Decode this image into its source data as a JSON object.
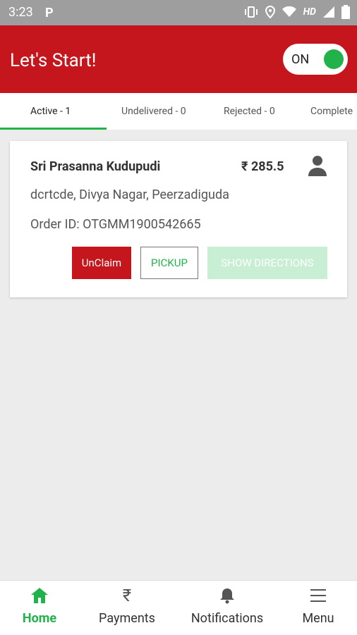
{
  "status_bar": {
    "time": "3:23",
    "left_icon": "P",
    "network_label": "HD"
  },
  "app_bar": {
    "title": "Let's Start!",
    "toggle_label": "ON"
  },
  "tabs": [
    {
      "label": "Active - 1"
    },
    {
      "label": "Undelivered - 0"
    },
    {
      "label": "Rejected - 0"
    },
    {
      "label": "Complete"
    }
  ],
  "order_card": {
    "customer_name": "Sri Prasanna Kudupudi",
    "price": "₹ 285.5",
    "address": "dcrtcde, Divya Nagar, Peerzadiguda",
    "order_id": "Order ID: OTGMM1900542665",
    "buttons": {
      "unclaim": "UnClaim",
      "pickup": "PICKUP",
      "show_directions": "SHOW DIRECTIONS"
    }
  },
  "bottom_nav": [
    {
      "label": "Home",
      "icon": "home-icon"
    },
    {
      "label": "Payments",
      "icon": "rupee-icon"
    },
    {
      "label": "Notifications",
      "icon": "bell-icon"
    },
    {
      "label": "Menu",
      "icon": "hamburger-icon"
    }
  ],
  "colors": {
    "brand_red": "#c4161c",
    "accent_green": "#22b24c",
    "disabled_green": "#c8efd3"
  }
}
